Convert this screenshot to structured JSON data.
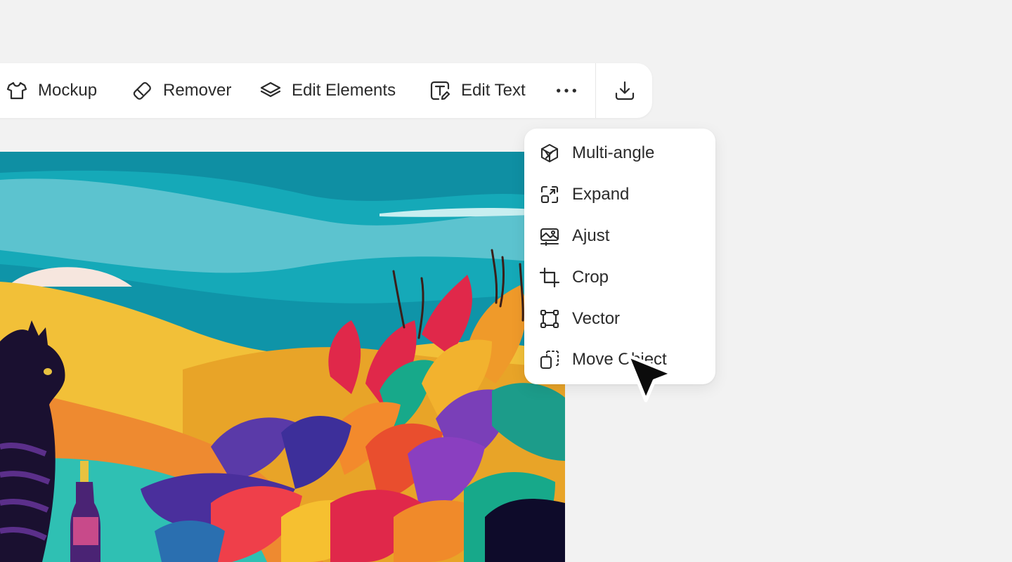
{
  "toolbar": {
    "items": [
      {
        "label": "Mockup",
        "icon": "tshirt-icon"
      },
      {
        "label": "Remover",
        "icon": "eraser-icon"
      },
      {
        "label": "Edit Elements",
        "icon": "layers-icon"
      },
      {
        "label": "Edit Text",
        "icon": "text-edit-icon"
      }
    ],
    "more_icon": "more-horizontal-icon",
    "download_icon": "download-icon"
  },
  "menu": {
    "items": [
      {
        "label": "Multi-angle",
        "icon": "cube-icon"
      },
      {
        "label": "Expand",
        "icon": "expand-icon"
      },
      {
        "label": "Ajust",
        "icon": "adjust-image-icon"
      },
      {
        "label": "Crop",
        "icon": "crop-icon"
      },
      {
        "label": "Vector",
        "icon": "vector-icon"
      },
      {
        "label": "Move Object",
        "icon": "move-object-icon"
      }
    ]
  },
  "colors": {
    "background": "#f2f2f2",
    "surface": "#ffffff",
    "text": "#2b2b2b",
    "sky_teal": "#17aab9",
    "sky_light": "#6cc9d4",
    "hill_yellow": "#f3c437",
    "hill_orange": "#ef8a2e",
    "leaf_red": "#e1284a",
    "leaf_purple": "#6c3bb0",
    "leaf_green": "#17a98a"
  }
}
